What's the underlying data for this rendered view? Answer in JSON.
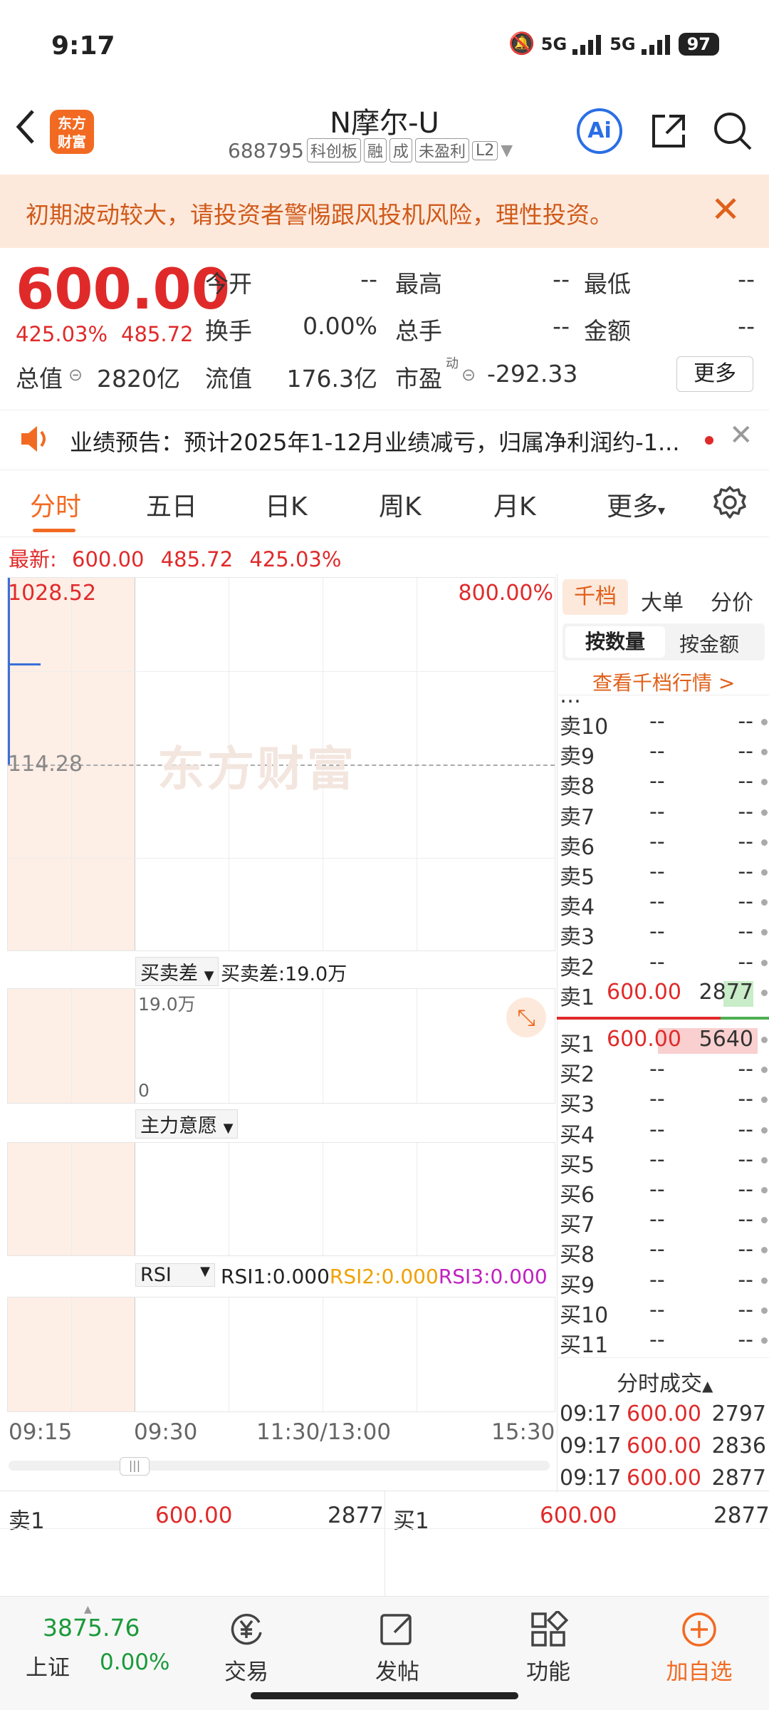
{
  "status_bar": {
    "time": "9:17",
    "net1": "5G",
    "net2": "5G",
    "battery": "97"
  },
  "header": {
    "back_icon": "chevron-left-icon",
    "logo_text": "东方财富",
    "title": "N摩尔-U",
    "code": "688795",
    "tags": [
      "科创板",
      "融",
      "成",
      "未盈利",
      "L2"
    ],
    "ai_label": "Ai"
  },
  "notice": {
    "text": "初期波动较大，请投资者警惕跟风投机风险，理性投资。"
  },
  "quote": {
    "price": "600.00",
    "change_pct": "425.03%",
    "change": "485.72",
    "fields": [
      {
        "label": "今开",
        "value": "--"
      },
      {
        "label": "最高",
        "value": "--"
      },
      {
        "label": "最低",
        "value": "--"
      },
      {
        "label": "换手",
        "value": "0.00%"
      },
      {
        "label": "总手",
        "value": "--"
      },
      {
        "label": "金额",
        "value": "--"
      },
      {
        "label": "总值",
        "value": "2820亿"
      },
      {
        "label": "流值",
        "value": "176.3亿"
      },
      {
        "label": "市盈",
        "value": "-292.33"
      }
    ],
    "pe_sup": "动",
    "more": "更多"
  },
  "forecast": {
    "text": "业绩预告：预计2025年1-12月业绩减亏，归属净利润约-1..."
  },
  "tabs": [
    "分时",
    "五日",
    "日K",
    "周K",
    "月K",
    "更多"
  ],
  "latest": {
    "label": "最新:",
    "price": "600.00",
    "change": "485.72",
    "pct": "425.03%"
  },
  "chart": {
    "y_top": "1028.52",
    "pct_top": "800.00%",
    "mid": "114.28",
    "watermark": "东方财富",
    "sub1_select": "买卖差",
    "sub1_value": "买卖差:19.0万",
    "sub1_top": "19.0万",
    "sub1_zero": "0",
    "sub2_select": "主力意愿",
    "sub3_select": "RSI",
    "rsi1": "RSI1:0.000",
    "rsi2": "RSI2:0.000",
    "rsi3": "RSI3:0.000",
    "times": [
      "09:15",
      "09:30",
      "11:30/13:00",
      "15:30"
    ]
  },
  "book": {
    "tabs": [
      "千档",
      "大单",
      "分价"
    ],
    "sub_tabs": [
      "按数量",
      "按金额"
    ],
    "link": "查看千档行情 >",
    "sells": [
      {
        "label": "卖10",
        "price": "--",
        "vol": "--"
      },
      {
        "label": "卖9",
        "price": "--",
        "vol": "--"
      },
      {
        "label": "卖8",
        "price": "--",
        "vol": "--"
      },
      {
        "label": "卖7",
        "price": "--",
        "vol": "--"
      },
      {
        "label": "卖6",
        "price": "--",
        "vol": "--"
      },
      {
        "label": "卖5",
        "price": "--",
        "vol": "--"
      },
      {
        "label": "卖4",
        "price": "--",
        "vol": "--"
      },
      {
        "label": "卖3",
        "price": "--",
        "vol": "--"
      },
      {
        "label": "卖2",
        "price": "--",
        "vol": "--"
      },
      {
        "label": "卖1",
        "price": "600.00",
        "vol": "2877"
      }
    ],
    "buys": [
      {
        "label": "买1",
        "price": "600.00",
        "vol": "5640"
      },
      {
        "label": "买2",
        "price": "--",
        "vol": "--"
      },
      {
        "label": "买3",
        "price": "--",
        "vol": "--"
      },
      {
        "label": "买4",
        "price": "--",
        "vol": "--"
      },
      {
        "label": "买5",
        "price": "--",
        "vol": "--"
      },
      {
        "label": "买6",
        "price": "--",
        "vol": "--"
      },
      {
        "label": "买7",
        "price": "--",
        "vol": "--"
      },
      {
        "label": "买8",
        "price": "--",
        "vol": "--"
      },
      {
        "label": "买9",
        "price": "--",
        "vol": "--"
      },
      {
        "label": "买10",
        "price": "--",
        "vol": "--"
      },
      {
        "label": "买11",
        "price": "--",
        "vol": "--"
      }
    ],
    "trades_title": "分时成交",
    "trades": [
      {
        "time": "09:17",
        "price": "600.00",
        "vol": "2797"
      },
      {
        "time": "09:17",
        "price": "600.00",
        "vol": "2836"
      },
      {
        "time": "09:17",
        "price": "600.00",
        "vol": "2877"
      }
    ]
  },
  "strip": {
    "left": {
      "label": "卖1",
      "price": "600.00",
      "vol": "2877"
    },
    "right": {
      "label": "买1",
      "price": "600.00",
      "vol": "2877"
    }
  },
  "nav": {
    "index_value": "3875.76",
    "index_name": "上证",
    "index_pct": "0.00%",
    "items": [
      "交易",
      "发帖",
      "功能",
      "加自选"
    ]
  },
  "colors": {
    "accent": "#f26a21",
    "up": "#e02a2a",
    "ai": "#2a6ee6"
  }
}
